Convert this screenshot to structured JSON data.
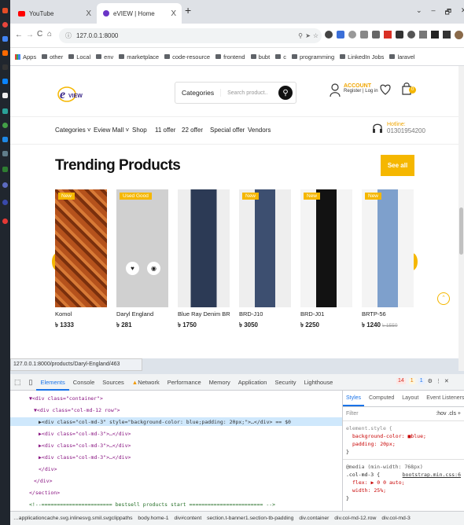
{
  "browser": {
    "tabs": [
      {
        "label": "YouTube",
        "close": "X"
      },
      {
        "label": "eVIEW | Home",
        "close": "X"
      }
    ],
    "new_tab": "+",
    "window_controls": [
      "⌄",
      "–",
      "🗗",
      "✕"
    ],
    "address": "127.0.0.1:8000",
    "bookmarks": [
      "Apps",
      "other",
      "Local",
      "env",
      "marketplace",
      "code-resource",
      "frontend",
      "bubt",
      "c",
      "programming",
      "LinkedIn Jobs",
      "laravel"
    ],
    "status_url": "127.0.0.1:8000/products/Daryl-England/463"
  },
  "site": {
    "logo_text": "VIEW",
    "search": {
      "category": "Categories",
      "placeholder": "Search product.."
    },
    "account": {
      "title": "ACCOUNT",
      "links": "Register | Log in"
    },
    "cart_count": "0",
    "nav": [
      "Categories ˅",
      "Eview Mall ˅",
      "Shop",
      "11 offer",
      "22 offer",
      "Special offer",
      "Vendors"
    ],
    "hotline": {
      "label": "Hotline:",
      "number": "01301954200"
    },
    "section_title": "Trending Products",
    "see_all": "See all",
    "arrow_left": "‹",
    "arrow_right": "›",
    "products": [
      {
        "name": "Komol",
        "price": "৳ 1333",
        "badge": "New",
        "img_color": "#b5521c",
        "old_price": ""
      },
      {
        "name": "Daryl England",
        "price": "৳ 281",
        "badge": "Used Good",
        "img_color": "#d0d0d0",
        "old_price": ""
      },
      {
        "name": "Blue Ray Denim BRD-J...",
        "price": "৳ 1750",
        "badge": "",
        "img_color": "#2c3a55",
        "old_price": ""
      },
      {
        "name": "BRD-J10",
        "price": "৳ 3050",
        "badge": "New",
        "img_color": "#3d4f70",
        "old_price": ""
      },
      {
        "name": "BRD-J01",
        "price": "৳ 2250",
        "badge": "New",
        "img_color": "#121212",
        "old_price": ""
      },
      {
        "name": "BRTP-56",
        "price": "৳ 1240",
        "badge": "New",
        "img_color": "#7ea0cc",
        "old_price": "৳ 1550"
      }
    ]
  },
  "devtools": {
    "tabs": [
      "Elements",
      "Console",
      "Sources",
      "Network",
      "Performance",
      "Memory",
      "Application",
      "Security",
      "Lighthouse"
    ],
    "issues": "14",
    "warnings": "1",
    "info": "1",
    "dom_lines": [
      "▼<div class=\"container\">",
      "▼<div class=\"col-md-12 row\">",
      "▶<div class=\"col-md-3\" style=\"background-color: blue;padding: 20px;\">…</div> == $0",
      "▶<div class=\"col-md-3\">…</div>",
      "▶<div class=\"col-md-3\">…</div>",
      "▶<div class=\"col-md-3\">…</div>",
      "</div>",
      "</div>",
      "</section>",
      "<!--======================= bestsell products start ======================== -->"
    ],
    "styles_tabs": [
      "Styles",
      "Computed",
      "Layout",
      "Event Listeners",
      "»"
    ],
    "filter_placeholder": "Filter",
    "filter_tools": ":hov  .cls  +",
    "rule1": {
      "selector": "element.style {",
      "props": [
        "background-color: ■blue;",
        "padding: 20px;"
      ],
      "close": "}"
    },
    "rule2": {
      "media": "@media (min-width: 768px)",
      "selector": ".col-md-3 {",
      "source": "bootstrap.min.css:6",
      "props": [
        "flex: ▶ 0 0 auto;",
        "width: 25%;"
      ],
      "close": "}"
    },
    "breadcrumbs": [
      "…applicationcache.svg.inlinesvg.smil.svgclippaths",
      "body.home-1",
      "div#content",
      "section.t-banner1.section-tb-padding",
      "div.container",
      "div.col-md-12.row",
      "div.col-md-3"
    ]
  },
  "colors": {
    "accent": "#f5b700",
    "devtools_blue": "#1a73e8"
  }
}
